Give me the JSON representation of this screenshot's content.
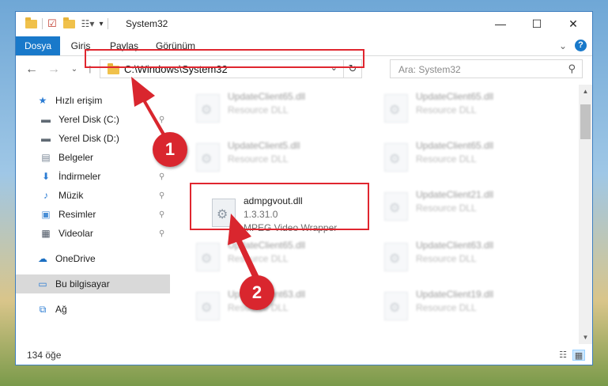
{
  "window": {
    "title": "System32"
  },
  "title_controls": {
    "minimize": "—",
    "maximize": "☐",
    "close": "✕"
  },
  "ribbon": {
    "tabs": [
      {
        "label": "Dosya"
      },
      {
        "label": "Giriş"
      },
      {
        "label": "Paylaş"
      },
      {
        "label": "Görünüm"
      }
    ],
    "expand": "⌄",
    "help": "?"
  },
  "nav": {
    "back": "←",
    "forward": "→",
    "recent": "⌄",
    "up": "↑",
    "address_path": "C:\\Windows\\System32",
    "address_chevron": "⌄",
    "refresh": "↻",
    "search_placeholder": "Ara: System32",
    "search_icon": "⚲"
  },
  "sidebar": {
    "items": [
      {
        "label": "Hızlı erişim",
        "icon": "star-icon",
        "glyph": "★",
        "color": "#2b7cd3",
        "pinned": false
      },
      {
        "label": "Yerel Disk (C:)",
        "icon": "drive-icon",
        "glyph": "▬",
        "color": "#606a74",
        "pinned": true
      },
      {
        "label": "Yerel Disk (D:)",
        "icon": "drive-icon",
        "glyph": "▬",
        "color": "#606a74",
        "pinned": true
      },
      {
        "label": "Belgeler",
        "icon": "documents-icon",
        "glyph": "▤",
        "color": "#7a8796",
        "pinned": true
      },
      {
        "label": "İndirmeler",
        "icon": "downloads-icon",
        "glyph": "⬇",
        "color": "#2b7cd3",
        "pinned": true
      },
      {
        "label": "Müzik",
        "icon": "music-icon",
        "glyph": "♪",
        "color": "#2b7cd3",
        "pinned": true
      },
      {
        "label": "Resimler",
        "icon": "pictures-icon",
        "glyph": "▣",
        "color": "#4a8fd6",
        "pinned": true
      },
      {
        "label": "Videolar",
        "icon": "videos-icon",
        "glyph": "▦",
        "color": "#4b5563",
        "pinned": true
      },
      {
        "label": "OneDrive",
        "icon": "cloud-icon",
        "glyph": "☁",
        "color": "#1b6fc2",
        "pinned": false
      },
      {
        "label": "Bu bilgisayar",
        "icon": "computer-icon",
        "glyph": "▭",
        "color": "#2b7cd3",
        "pinned": false
      },
      {
        "label": "Ağ",
        "icon": "network-icon",
        "glyph": "⧉",
        "color": "#2b7cd3",
        "pinned": false
      }
    ],
    "pin_glyph": "📌"
  },
  "files": [
    {
      "name": "UpdateClient65.dll",
      "desc": "Resource DLL",
      "blurred": true
    },
    {
      "name": "UpdateClient65.dll",
      "desc": "Resource DLL",
      "blurred": true
    },
    {
      "name": "UpdateClient5.dll",
      "desc": "Resource DLL",
      "blurred": true
    },
    {
      "name": "UpdateClient65.dll",
      "desc": "Resource DLL",
      "blurred": true
    },
    {
      "name": "admpgvout.dll",
      "version": "1.3.31.0",
      "desc": "MPEG Video Wrapper",
      "blurred": false
    },
    {
      "name": "UpdateClient21.dll",
      "desc": "Resource DLL",
      "blurred": true
    },
    {
      "name": "UpdateClient65.dll",
      "desc": "Resource DLL",
      "blurred": true
    },
    {
      "name": "UpdateClient63.dll",
      "desc": "Resource DLL",
      "blurred": true
    },
    {
      "name": "UpdateClient63.dll",
      "desc": "Resource DLL",
      "blurred": true
    },
    {
      "name": "UpdateClient19.dll",
      "desc": "Resource DLL",
      "blurred": true
    }
  ],
  "status": {
    "count": "134 öğe"
  },
  "annotations": {
    "step1": "1",
    "step2": "2",
    "color": "#d9262e"
  }
}
